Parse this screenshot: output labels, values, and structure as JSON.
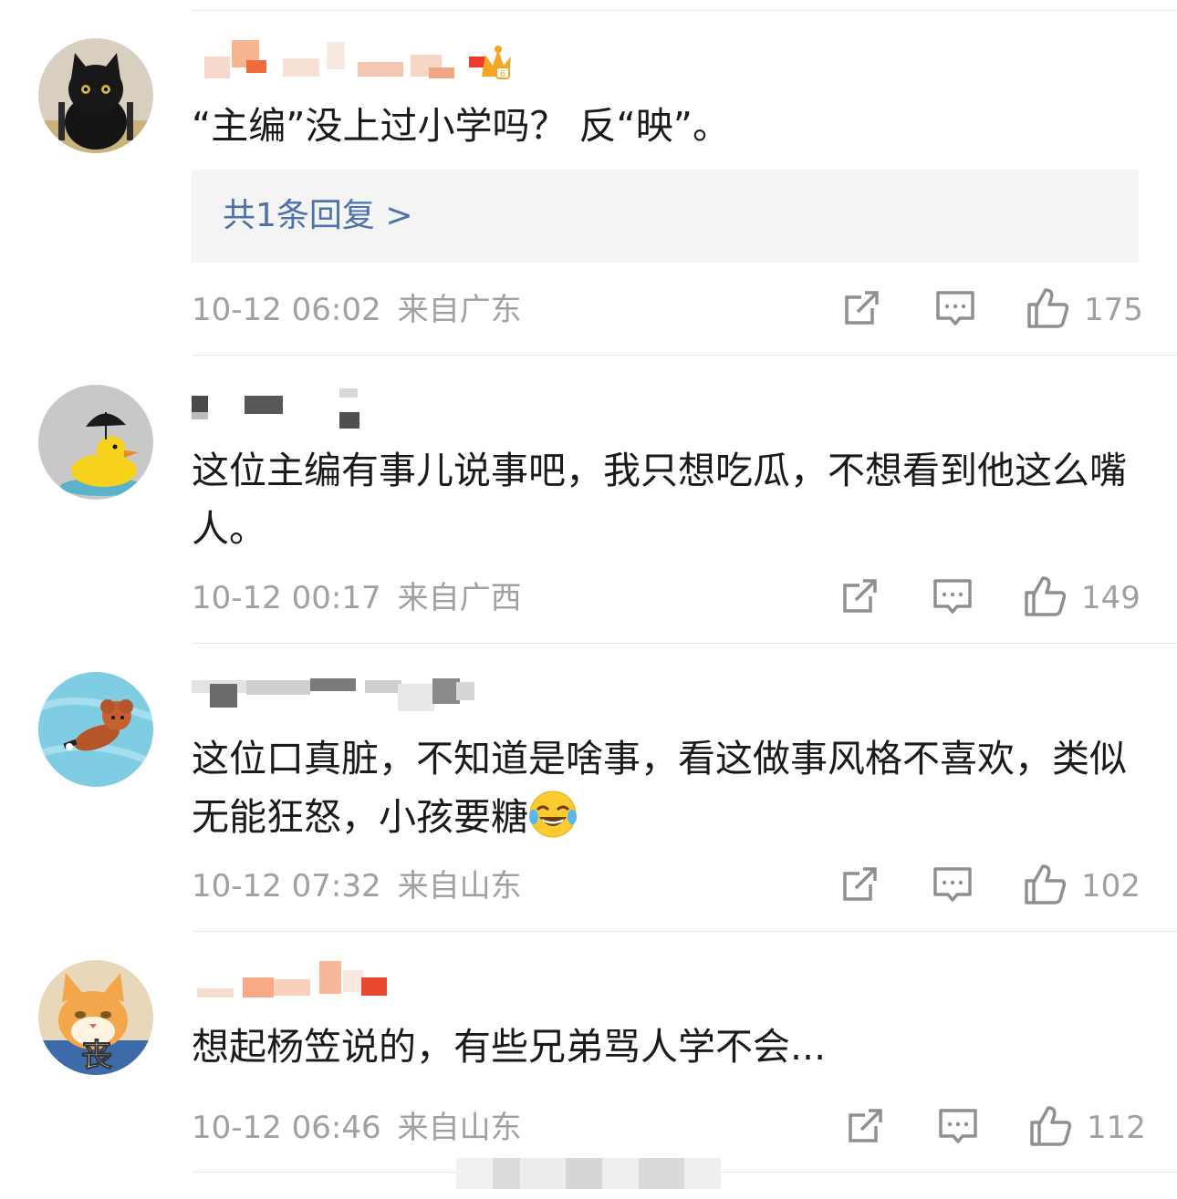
{
  "comments": [
    {
      "avatar_icon": "black-cat-avatar",
      "badge_icon": "crown-icon",
      "text": "“主编”没上过小学吗？ 反“映”。",
      "reply_label": "共1条回复 >",
      "time": "10-12 06:02",
      "location": "来自广东",
      "likes": "175"
    },
    {
      "avatar_icon": "rubber-duck-umbrella-avatar",
      "text": "这位主编有事儿说事吧，我只想吃瓜，不想看到他这么嘴人。",
      "time": "10-12 00:17",
      "location": "来自广西",
      "likes": "149"
    },
    {
      "avatar_icon": "brown-puppy-avatar",
      "text": "这位口真脏，不知道是啥事，看这做事风格不喜欢，类似无能狂怒，小孩要糖",
      "emoji_icon": "laughing-tears-emoji",
      "time": "10-12 07:32",
      "location": "来自山东",
      "likes": "102"
    },
    {
      "avatar_icon": "orange-cat-avatar",
      "avatar_caption": "丧",
      "text": "想起杨笠说的，有些兄弟骂人学不会...",
      "time": "10-12 06:46",
      "location": "来自山东",
      "likes": "112"
    }
  ],
  "colors": {
    "link_blue": "#4e72a8",
    "meta_gray": "#a0a0a0",
    "reply_bg": "#f4f4f4",
    "divider": "#e6e6e6"
  },
  "action_icons": [
    "share-icon",
    "comment-icon",
    "like-icon"
  ]
}
